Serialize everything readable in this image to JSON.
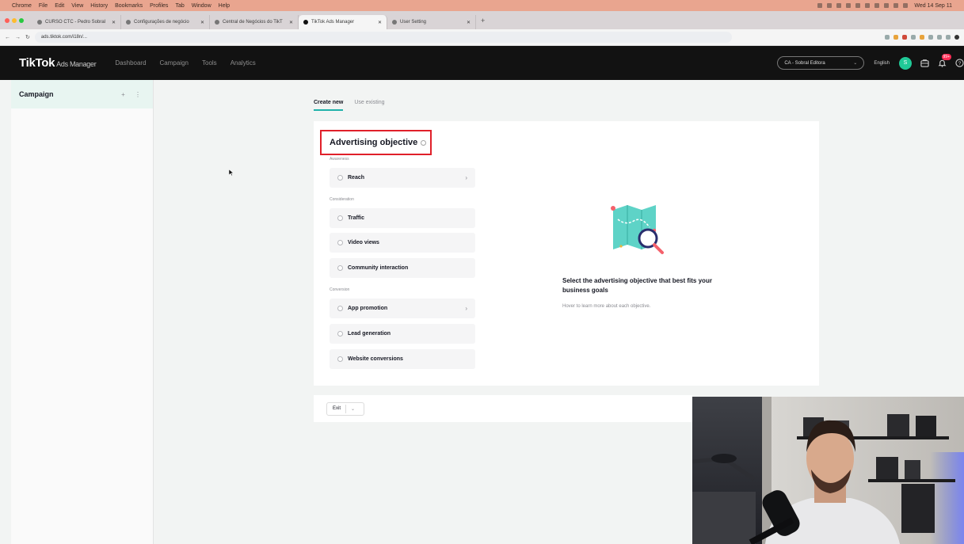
{
  "mac_menubar": {
    "items": [
      "Chrome",
      "File",
      "Edit",
      "View",
      "History",
      "Bookmarks",
      "Profiles",
      "Tab",
      "Window",
      "Help"
    ],
    "clock": "Wed 14 Sep 11"
  },
  "browser": {
    "tabs": [
      {
        "label": "CURSO CTC - Pedro Sobral"
      },
      {
        "label": "Configurações de negócio"
      },
      {
        "label": "Central de Negócios do TikT"
      },
      {
        "label": "TikTok Ads Manager",
        "active": true
      },
      {
        "label": "User Setting"
      }
    ],
    "new_tab": "+",
    "url": "ads.tiktok.com/i18n/..."
  },
  "topnav": {
    "logo": "TikTok",
    "logo_sub": "Ads Manager",
    "items": [
      "Dashboard",
      "Campaign",
      "Tools",
      "Analytics"
    ],
    "account": "CA - Sobral Editora",
    "language": "English",
    "avatar_initial": "S",
    "notifications_badge": "99+"
  },
  "sidebar": {
    "title": "Campaign",
    "actions": "+ ⋮"
  },
  "creation_tabs": {
    "create_new": "Create new",
    "use_existing": "Use existing"
  },
  "objective": {
    "title": "Advertising objective",
    "groups": [
      {
        "label": "Awareness",
        "options": [
          {
            "label": "Reach",
            "has_chevron": true
          }
        ]
      },
      {
        "label": "Consideration",
        "options": [
          {
            "label": "Traffic",
            "has_chevron": false
          },
          {
            "label": "Video views",
            "has_chevron": false
          },
          {
            "label": "Community interaction",
            "has_chevron": false
          }
        ]
      },
      {
        "label": "Conversion",
        "options": [
          {
            "label": "App promotion",
            "has_chevron": true
          },
          {
            "label": "Lead generation",
            "has_chevron": false
          },
          {
            "label": "Website conversions",
            "has_chevron": false
          }
        ]
      }
    ],
    "hint_title": "Select the advertising objective that best fits your business goals",
    "hint_sub": "Hover to learn more about each objective."
  },
  "footer": {
    "exit_label": "Exit"
  },
  "icons": {
    "chevron": "›",
    "dropdown": "⌄"
  },
  "colors": {
    "accent": "#20b2aa",
    "highlight_box": "#e0202a",
    "topnav_bg": "#121212",
    "badge": "#fe2c55"
  }
}
